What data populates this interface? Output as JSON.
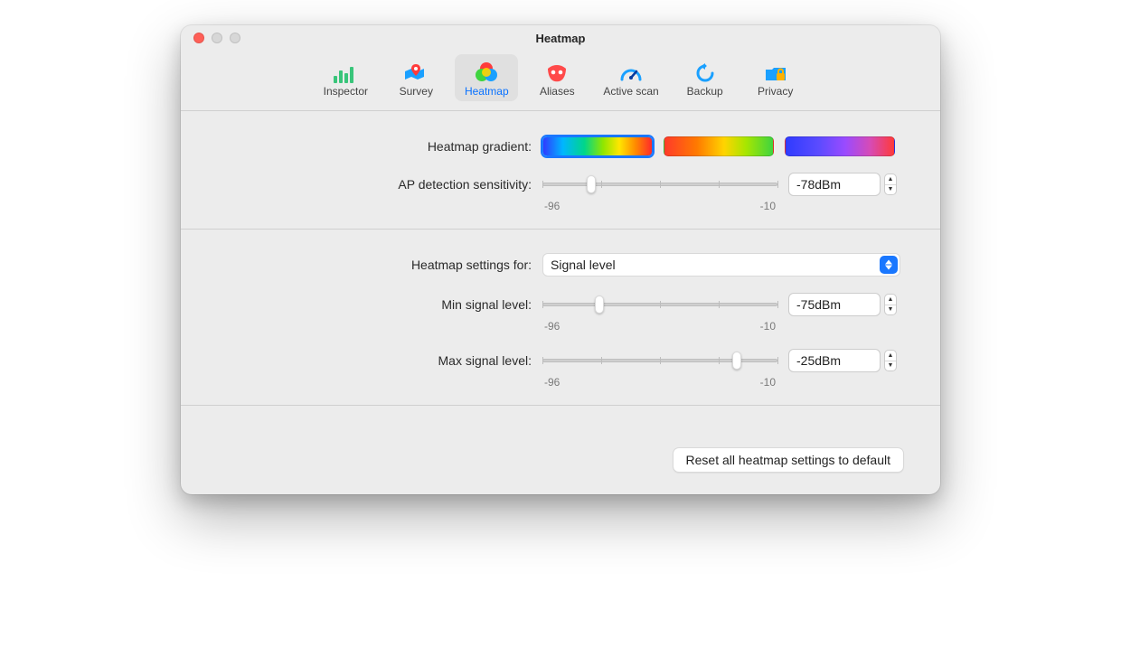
{
  "window": {
    "title": "Heatmap"
  },
  "tabs": [
    {
      "label": "Inspector"
    },
    {
      "label": "Survey"
    },
    {
      "label": "Heatmap"
    },
    {
      "label": "Aliases"
    },
    {
      "label": "Active scan"
    },
    {
      "label": "Backup"
    },
    {
      "label": "Privacy"
    }
  ],
  "active_tab_index": 2,
  "gradient": {
    "label": "Heatmap gradient:",
    "selected_index": 0,
    "options": [
      {
        "css": "linear-gradient(90deg,#2f3bff 0%,#00b6ff 18%,#00d68a 38%,#8fe600 55%,#ffe600 70%,#ff8a00 85%,#ff2a2a 100%)"
      },
      {
        "css": "linear-gradient(90deg,#ff3a2a 0%,#ff7a00 30%,#ffd400 55%,#a8e600 75%,#3fd43f 100%)"
      },
      {
        "css": "linear-gradient(90deg,#2f3bff 0%,#5a4bff 30%,#9a4bff 55%,#d64bb6 78%,#ff3a3a 100%)"
      }
    ]
  },
  "ap_sensitivity": {
    "label": "AP detection sensitivity:",
    "min": -96,
    "max": -10,
    "value": -78,
    "value_display": "-78dBm",
    "min_label": "-96",
    "max_label": "-10"
  },
  "settings_for": {
    "label": "Heatmap settings for:",
    "selected": "Signal level"
  },
  "min_signal": {
    "label": "Min signal level:",
    "min": -96,
    "max": -10,
    "value": -75,
    "value_display": "-75dBm",
    "min_label": "-96",
    "max_label": "-10"
  },
  "max_signal": {
    "label": "Max signal level:",
    "min": -96,
    "max": -10,
    "value": -25,
    "value_display": "-25dBm",
    "min_label": "-96",
    "max_label": "-10"
  },
  "reset_label": "Reset all heatmap settings to default"
}
